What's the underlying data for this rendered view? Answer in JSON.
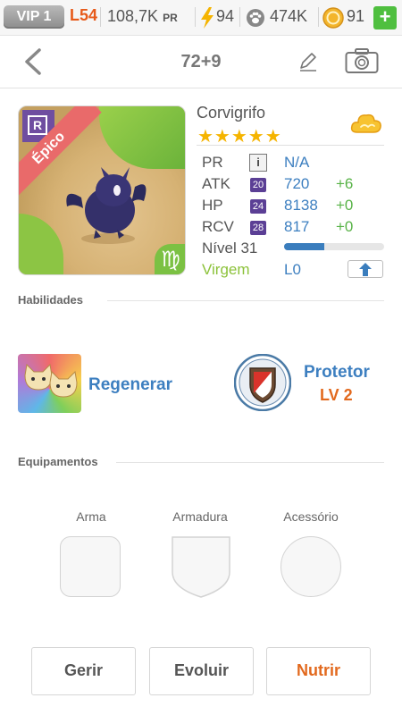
{
  "status_bar": {
    "vip": "VIP 1",
    "level": "L54",
    "pr_value": "108,7K",
    "pr_label": "PR",
    "energy": "94",
    "paw_currency": "474K",
    "coins": "91",
    "plus": "+"
  },
  "header": {
    "title": "72+9"
  },
  "pet": {
    "rarity": "Épico",
    "rarity_icon": "R",
    "zodiac_symbol": "♍",
    "name": "Corvigrifo",
    "stars": "★★★★★",
    "star_count": 5,
    "stats": [
      {
        "label": "PR",
        "value": "N/A"
      },
      {
        "label": "ATK",
        "badge": "20",
        "value": "720",
        "bonus": "+6"
      },
      {
        "label": "HP",
        "badge": "24",
        "value": "8138",
        "bonus": "+0"
      },
      {
        "label": "RCV",
        "badge": "28",
        "value": "817",
        "bonus": "+0"
      }
    ],
    "info_icon": "i",
    "level_label": "Nível 31",
    "level_progress": 0.4,
    "zodiac": "Virgem",
    "stage": "L0"
  },
  "skills": {
    "section_title": "Habilidades",
    "items": [
      {
        "name": "Regenerar"
      },
      {
        "name": "Protetor",
        "level": "LV 2"
      }
    ]
  },
  "equipment": {
    "section_title": "Equipamentos",
    "slots": [
      {
        "label": "Arma"
      },
      {
        "label": "Armadura"
      },
      {
        "label": "Acessório"
      }
    ]
  },
  "actions": {
    "manage": "Gerir",
    "evolve": "Evoluir",
    "feed": "Nutrir"
  },
  "colors": {
    "accent_blue": "#3d7fc0",
    "accent_orange": "#e2691e",
    "bonus_green": "#58b347",
    "epic_red": "#e96a6a"
  },
  "icons": [
    "back-arrow-icon",
    "edit-pencil-icon",
    "camera-icon",
    "energy-bolt-icon",
    "paw-icon",
    "coin-icon",
    "cloud-icon",
    "upgrade-arrow-icon",
    "shield-icon"
  ]
}
